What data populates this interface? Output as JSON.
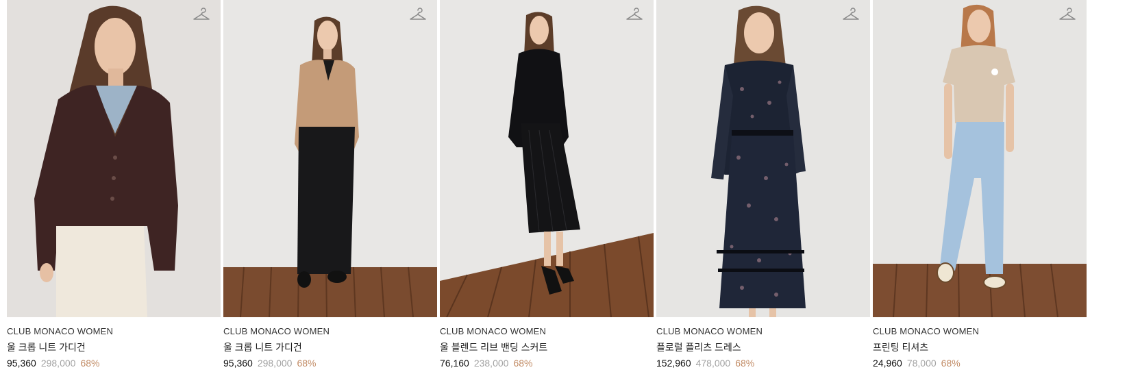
{
  "products": [
    {
      "brand": "CLUB MONACO WOMEN",
      "name": "울 크롭 니트 가디건",
      "price": "95,360",
      "original_price": "298,000",
      "discount": "68%",
      "image": "model-brown-cardigan"
    },
    {
      "brand": "CLUB MONACO WOMEN",
      "name": "울 크롭 니트 가디건",
      "price": "95,360",
      "original_price": "298,000",
      "discount": "68%",
      "image": "model-beige-cardigan"
    },
    {
      "brand": "CLUB MONACO WOMEN",
      "name": "울 블렌드 리브 밴딩 스커트",
      "price": "76,160",
      "original_price": "238,000",
      "discount": "68%",
      "image": "model-black-knit-set"
    },
    {
      "brand": "CLUB MONACO WOMEN",
      "name": "플로럴 플리츠 드레스",
      "price": "152,960",
      "original_price": "478,000",
      "discount": "68%",
      "image": "model-floral-dress"
    },
    {
      "brand": "CLUB MONACO WOMEN",
      "name": "프린팅 티셔츠",
      "price": "24,960",
      "original_price": "78,000",
      "discount": "68%",
      "image": "model-beige-tee"
    }
  ],
  "icons": {
    "wishlist": "hanger-icon"
  },
  "colors": {
    "price": "#111111",
    "original_price": "#a3a3a3",
    "discount": "#c28c66",
    "brand": "#333333"
  }
}
